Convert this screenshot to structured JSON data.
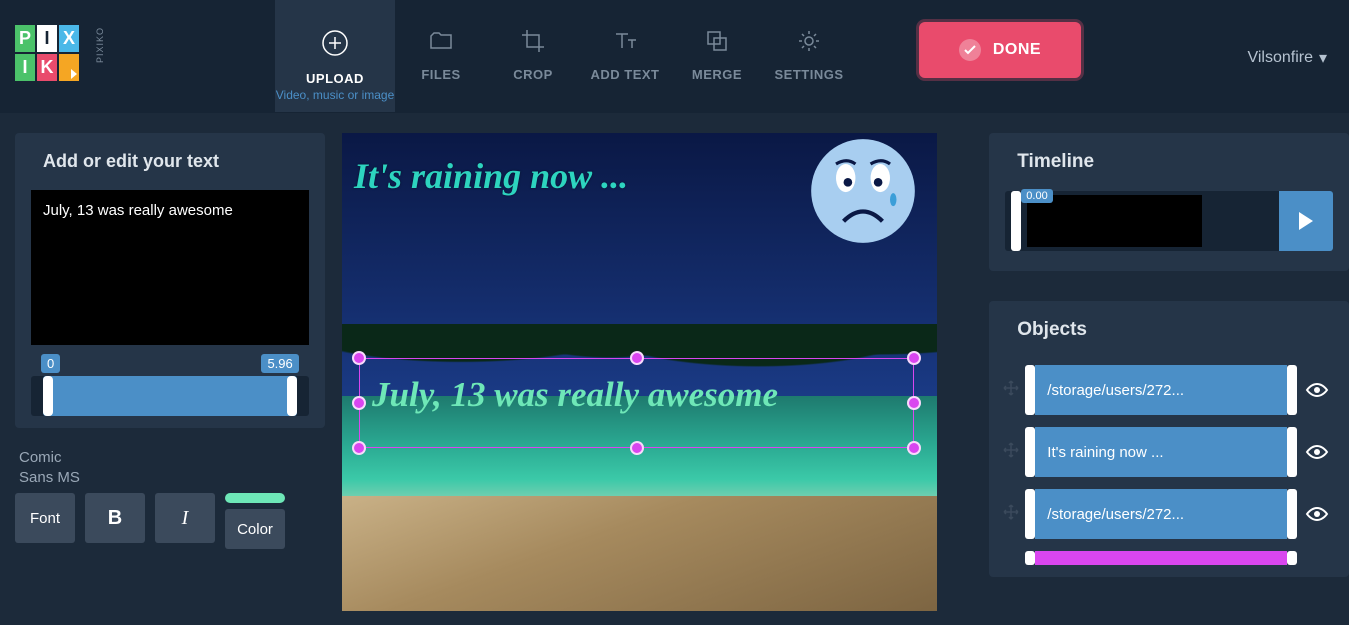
{
  "logo": {
    "letters": [
      "P",
      "I",
      "X",
      "I",
      "K",
      "O"
    ],
    "side_text": "PIXIKO"
  },
  "toolbar": {
    "upload": {
      "label": "UPLOAD",
      "sub": "Video, music or image"
    },
    "files": {
      "label": "FILES"
    },
    "crop": {
      "label": "CROP"
    },
    "addtext": {
      "label": "ADD TEXT"
    },
    "merge": {
      "label": "MERGE"
    },
    "settings": {
      "label": "SETTINGS"
    },
    "done": {
      "label": "DONE"
    }
  },
  "user": {
    "name": "Vilsonfire"
  },
  "left": {
    "header": "Add or edit your text",
    "text_value": "July, 13 was really awesome",
    "range_start": "0",
    "range_end": "5.96",
    "font_name": "Comic\nSans MS",
    "font_btn": "Font",
    "bold_btn": "B",
    "italic_btn": "I",
    "color_btn": "Color",
    "color_value": "#6ee7b7"
  },
  "canvas": {
    "text1": "It's raining now ...",
    "text2": "July, 13 was really awesome"
  },
  "timeline": {
    "header": "Timeline",
    "position": "0.00"
  },
  "objects": {
    "header": "Objects",
    "items": [
      {
        "label": "/storage/users/272..."
      },
      {
        "label": "It's raining now ..."
      },
      {
        "label": "/storage/users/272..."
      }
    ]
  }
}
